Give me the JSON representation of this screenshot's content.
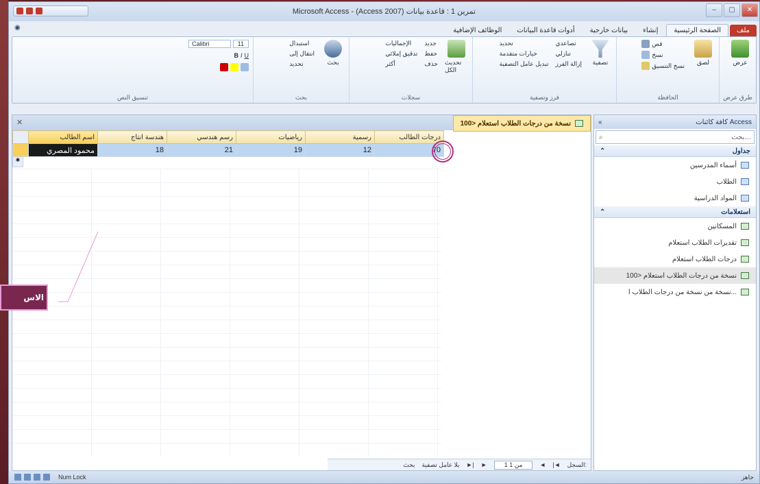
{
  "window": {
    "title": "Microsoft Access - (Access 2007) تمرين 1 : قاعدة بيانات",
    "controls": [
      "‒",
      "▢",
      "✕"
    ]
  },
  "ribbon_tabs": [
    "ملف",
    "الصفحة الرئيسية",
    "إنشاء",
    "بيانات خارجية",
    "أدوات قاعدة البيانات",
    "الوظائف الإضافية"
  ],
  "ribbon": {
    "groups": [
      {
        "label": "طرق عرض",
        "buttons": [
          "عرض"
        ]
      },
      {
        "label": "الحافظة",
        "buttons": [
          "لصق",
          "قص",
          "نسخ",
          "نسخ التنسيق"
        ]
      },
      {
        "label": "فرز وتصفية",
        "buttons": [
          "تصفية",
          "تصاعدي",
          "تنازلي",
          "إزالة الفرز",
          "تحديد",
          "خيارات متقدمة",
          "تبديل عامل التصفية"
        ]
      },
      {
        "label": "سجلات",
        "buttons": [
          "تحديث الكل",
          "جديد",
          "حفظ",
          "حذف",
          "الإجماليات",
          "تدقيق إملائي",
          "أكثر"
        ]
      },
      {
        "label": "بحث",
        "buttons": [
          "بحث",
          "استبدال",
          "انتقال إلى",
          "تحديد"
        ]
      },
      {
        "label": "تنسيق النص",
        "buttons": [
          "Calibri",
          "11",
          "B",
          "I",
          "U"
        ]
      }
    ]
  },
  "navigation": {
    "header": "كافة كائنات Access",
    "search_placeholder": "بحث...",
    "sections": [
      {
        "title": "جداول",
        "items": [
          "أسماء المدرسين",
          "الطلاب",
          "المواد الدراسية"
        ]
      },
      {
        "title": "استعلامات",
        "items": [
          "المسكانين",
          "تقديرات الطلاب استعلام",
          "درجات الطلاب استعلام",
          "نسخة من درجات الطلاب استعلام <100",
          "نسخة من نسخة من درجات الطلاب ا..."
        ]
      }
    ],
    "selected_item": "نسخة من درجات الطلاب استعلام <100"
  },
  "document": {
    "tab_title": "نسخة من درجات الطلاب استعلام <100",
    "columns": [
      "اسم الطالب",
      "هندسة انتاج",
      "رسم هندسي",
      "رياضيات",
      "رسمية",
      "درجات الطالب"
    ],
    "rows": [
      [
        "محمود المصري",
        "18",
        "21",
        "19",
        "12",
        "70"
      ]
    ]
  },
  "record_nav": {
    "label": "السجل:",
    "position": "1 من 1",
    "filter": "بلا عامل تصفية",
    "search": "بحث"
  },
  "status": {
    "left": "جاهز",
    "right": "Num Lock"
  },
  "callout": {
    "text": "الاس"
  },
  "colors": {
    "accent_file_tab": "#c0392b",
    "selection": "#bcd6f2",
    "header": "#f3e2a6",
    "highlight": "#b03080"
  }
}
